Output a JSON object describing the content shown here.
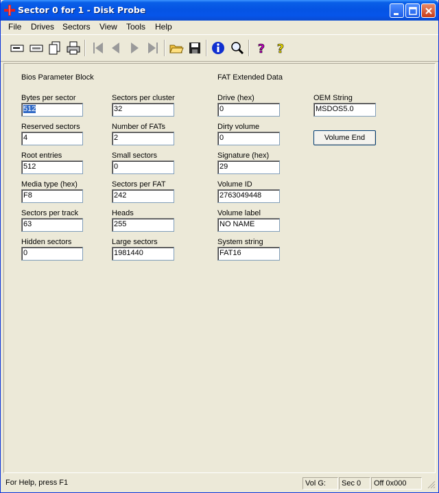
{
  "window": {
    "title": "Sector 0 for 1 - Disk Probe"
  },
  "menu": {
    "items": [
      "File",
      "Drives",
      "Sectors",
      "View",
      "Tools",
      "Help"
    ]
  },
  "toolbar": {
    "icons": [
      "open-drive-icon",
      "read-sectors-icon",
      "copy-page-icon",
      "print-icon",
      "first-sector-icon",
      "previous-sector-icon",
      "next-sector-icon",
      "last-sector-icon",
      "open-file-icon",
      "save-icon",
      "info-icon",
      "search-icon",
      "help-icon",
      "context-help-icon"
    ]
  },
  "bpb": {
    "heading": "Bios Parameter Block",
    "bytes_per_sector": {
      "label": "Bytes per sector",
      "value": "512"
    },
    "reserved_sectors": {
      "label": "Reserved sectors",
      "value": "4"
    },
    "root_entries": {
      "label": "Root entries",
      "value": "512"
    },
    "media_type": {
      "label": "Media type (hex)",
      "value": "F8"
    },
    "sectors_per_track": {
      "label": "Sectors per track",
      "value": "63"
    },
    "hidden_sectors": {
      "label": "Hidden sectors",
      "value": "0"
    },
    "sectors_per_cluster": {
      "label": "Sectors per cluster",
      "value": "32"
    },
    "number_of_fats": {
      "label": "Number of FATs",
      "value": "2"
    },
    "small_sectors": {
      "label": "Small sectors",
      "value": "0"
    },
    "sectors_per_fat": {
      "label": "Sectors per FAT",
      "value": "242"
    },
    "heads": {
      "label": "Heads",
      "value": "255"
    },
    "large_sectors": {
      "label": "Large sectors",
      "value": "1981440"
    }
  },
  "fat_ext": {
    "heading": "FAT Extended Data",
    "drive": {
      "label": "Drive (hex)",
      "value": "0"
    },
    "dirty_volume": {
      "label": "Dirty volume",
      "value": "0"
    },
    "signature": {
      "label": "Signature (hex)",
      "value": "29"
    },
    "volume_id": {
      "label": "Volume ID",
      "value": "2763049448"
    },
    "volume_label": {
      "label": "Volume label",
      "value": "NO NAME"
    },
    "system_string": {
      "label": "System string",
      "value": "FAT16"
    }
  },
  "oem": {
    "label": "OEM String",
    "value": "MSDOS5.0",
    "volume_end_button": "Volume End"
  },
  "status": {
    "help": "For Help, press F1",
    "vol": "Vol  G:",
    "sec": "Sec 0",
    "off": "Off 0x000"
  },
  "colors": {
    "titlebar": "#0554e3",
    "face": "#ece9d8",
    "selection": "#316ac5"
  }
}
